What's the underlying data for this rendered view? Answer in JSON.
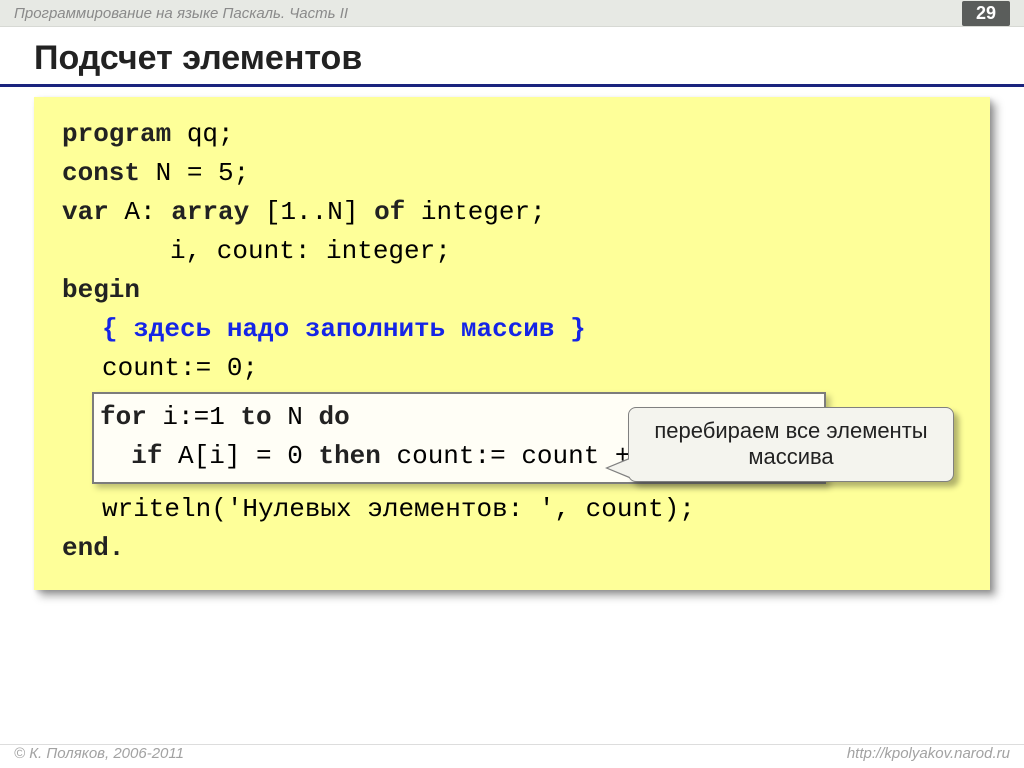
{
  "header": {
    "title": "Программирование на языке Паскаль. Часть II",
    "slide_number": "29"
  },
  "slide_title": "Подсчет элементов",
  "code": {
    "l1_kw": "program",
    "l1_rest": " qq;",
    "l2_kw": "const",
    "l2_rest": " N = 5;",
    "l3_kw": "var",
    "l3_mid": " A: ",
    "l3_arr": "array",
    "l3_mid2": " [1..N] ",
    "l3_of": "of",
    "l3_rest": " integer;",
    "l4": "i, count: integer;",
    "l5": "begin",
    "l6_comment": "{ здесь надо заполнить массив }",
    "l7": "count:= 0;",
    "l8_kw1": "for",
    "l8_mid1": " i:=1 ",
    "l8_kw2": "to",
    "l8_mid2": " N ",
    "l8_kw3": "do",
    "l9_kw": "if",
    "l9_mid": " A[i] = 0 ",
    "l9_kw2": "then",
    "l9_rest": " count:= count + 1;",
    "l10": "writeln('Нулевых элементов: ', count);",
    "l11": "end."
  },
  "callout": "перебираем все элементы массива",
  "footer": {
    "left": "© К. Поляков, 2006-2011",
    "right": "http://kpolyakov.narod.ru"
  }
}
